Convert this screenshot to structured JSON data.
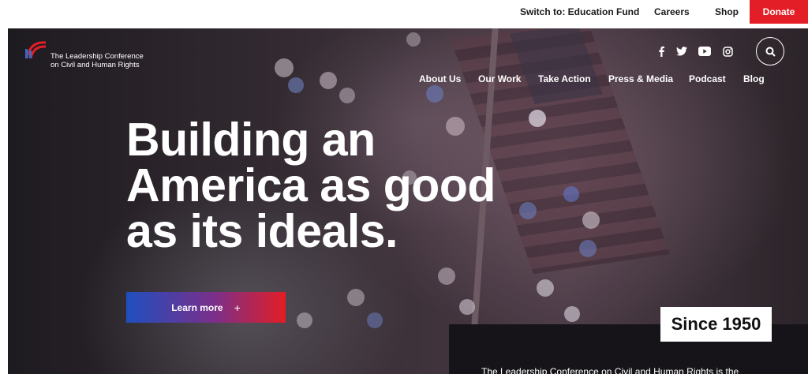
{
  "utility": {
    "education_fund": "Switch to: Education Fund",
    "careers": "Careers",
    "shop": "Shop",
    "donate": "Donate"
  },
  "logo": {
    "line1": "The Leadership Conference",
    "line2": "on Civil and Human Rights"
  },
  "social_icons": [
    "facebook-icon",
    "twitter-icon",
    "youtube-icon",
    "instagram-icon"
  ],
  "nav": {
    "items": [
      {
        "label": "About Us"
      },
      {
        "label": "Our Work"
      },
      {
        "label": "Take Action"
      },
      {
        "label": "Press & Media"
      },
      {
        "label": "Podcast"
      },
      {
        "label": "Blog"
      }
    ]
  },
  "hero": {
    "headline_line1": "Building an",
    "headline_line2": "America as good",
    "headline_line3": "as its ideals.",
    "cta_label": "Learn more",
    "cta_icon": "+"
  },
  "intro": {
    "badge": "Since 1950",
    "text": "The Leadership Conference on Civil and Human Rights is the"
  },
  "colors": {
    "donate": "#e31e26",
    "cta_gradient_start": "#1f4fbf",
    "cta_gradient_end": "#e31e26",
    "panel": "#161418"
  }
}
